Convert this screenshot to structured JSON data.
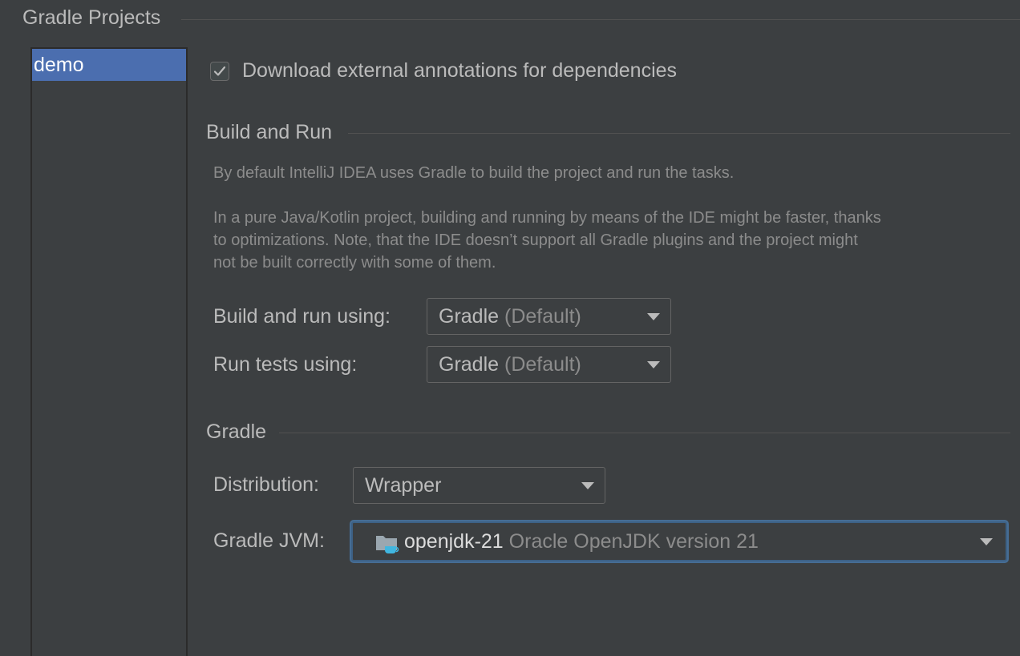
{
  "header": {
    "group_title": "Gradle Projects"
  },
  "projects": {
    "items": [
      "demo"
    ],
    "selected_index": 0
  },
  "options": {
    "download_annotations_label": "Download external annotations for dependencies",
    "download_annotations_checked": true
  },
  "build_and_run": {
    "title": "Build and Run",
    "desc1": "By default IntelliJ IDEA uses Gradle to build the project and run the tasks.",
    "desc2_line1": "In a pure Java/Kotlin project, building and running by means of the IDE might be faster, thanks",
    "desc2_line2": "to optimizations. Note, that the IDE doesn’t support all Gradle plugins and the project might",
    "desc2_line3": "not be built correctly with some of them.",
    "build_label": "Build and run using:",
    "build_value": "Gradle",
    "build_hint": "(Default)",
    "tests_label": "Run tests using:",
    "tests_value": "Gradle",
    "tests_hint": "(Default)"
  },
  "gradle": {
    "title": "Gradle",
    "distribution_label": "Distribution:",
    "distribution_value": "Wrapper",
    "jvm_label": "Gradle JVM:",
    "jvm_value": "openjdk-21",
    "jvm_hint": "Oracle OpenJDK version 21",
    "jvm_icon": "jdk-folder-icon"
  },
  "colors": {
    "background": "#3c3f41",
    "selection": "#4b6eaf",
    "focus": "#466d94"
  }
}
